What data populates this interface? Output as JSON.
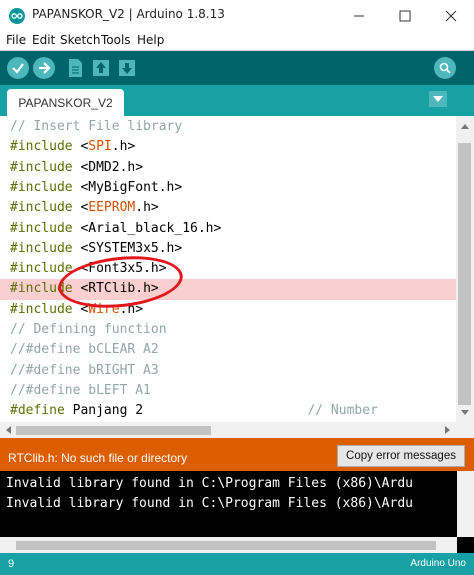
{
  "window": {
    "title": "PAPANSKOR_V2 | Arduino 1.8.13",
    "controls": {
      "minimize": "—",
      "maximize": "☐",
      "close": "✕"
    }
  },
  "menu": [
    "File",
    "Edit",
    "Sketch",
    "Tools",
    "Help"
  ],
  "toolbar": {
    "buttons": [
      "verify-icon",
      "upload-icon",
      "new-icon",
      "open-icon",
      "save-icon",
      "serial-monitor-icon"
    ]
  },
  "tabs": {
    "active": "PAPANSKOR_V2",
    "menu_icon": "dropdown-triangle-icon"
  },
  "code": [
    {
      "pre": "// Insert File library",
      "kind": "comment"
    },
    {
      "kw": "#include",
      "open": " <",
      "lib": "SPI",
      "ext": ".h>",
      "kind": "include-colored"
    },
    {
      "kw": "#include",
      "open": " <",
      "lib": "DMD2.h>",
      "ext": "",
      "kind": "include-plain"
    },
    {
      "kw": "#include",
      "open": " <",
      "lib": "MyBigFont.h>",
      "ext": "",
      "kind": "include-plain"
    },
    {
      "kw": "#include",
      "open": " <",
      "lib": "EEPROM",
      "ext": ".h>",
      "kind": "include-colored"
    },
    {
      "kw": "#include",
      "open": " <",
      "lib": "Arial_black_16.h>",
      "ext": "",
      "kind": "include-plain"
    },
    {
      "kw": "#include",
      "open": " <",
      "lib": "SYSTEM3x5.h>",
      "ext": "",
      "kind": "include-plain"
    },
    {
      "kw": "#include",
      "open": " <",
      "lib": "Font3x5.h>",
      "ext": "",
      "kind": "include-plain"
    },
    {
      "kw": "#include",
      "open": " <",
      "lib": "RTClib.h>",
      "ext": "",
      "kind": "include-plain",
      "highlight": true
    },
    {
      "kw": "#include",
      "open": " <",
      "lib": "Wire",
      "ext": ".h>",
      "kind": "include-colored"
    },
    {
      "pre": "// Defining function",
      "kind": "comment"
    },
    {
      "pre": "//#define bCLEAR A2",
      "kind": "comment"
    },
    {
      "pre": "//#define bRIGHT A3",
      "kind": "comment"
    },
    {
      "pre": "//#define bLEFT A1",
      "kind": "comment"
    },
    {
      "kw": "#define",
      "rest": " Panjang 2",
      "tail": "// Number",
      "kind": "define"
    }
  ],
  "error": {
    "message": "RTClib.h: No such file or directory",
    "copy_button": "Copy error messages"
  },
  "console": [
    "Invalid library found in C:\\Program Files (x86)\\Ardu",
    "Invalid library found in C:\\Program Files (x86)\\Ardu"
  ],
  "status": {
    "line_number": "9",
    "board": "Arduino Uno"
  },
  "colors": {
    "toolbar": "#006468",
    "tabbar": "#17a1a5",
    "error": "#dd5e00",
    "highlight": "#f9cfcf",
    "annotation": "#e3161b"
  }
}
